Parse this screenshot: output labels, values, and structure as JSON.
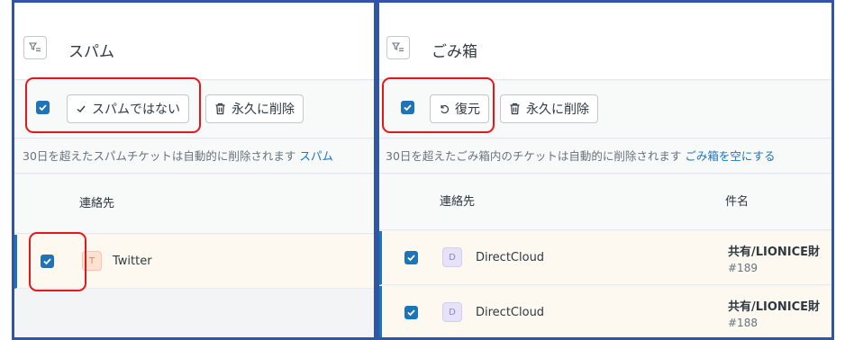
{
  "spam": {
    "title": "スパム",
    "not_spam_label": "スパムではない",
    "delete_label": "永久に削除",
    "notice_text": "30日を超えたスパムチケットは自動的に削除されます",
    "notice_link": "スパム",
    "contact_header": "連絡先",
    "rows": [
      {
        "avatar": "T",
        "contact": "Twitter"
      }
    ]
  },
  "trash": {
    "title": "ごみ箱",
    "restore_label": "復元",
    "delete_label": "永久に削除",
    "notice_text": "30日を超えたごみ箱内のチケットは自動的に削除されます",
    "notice_link": "ごみ箱を空にする",
    "contact_header": "連絡先",
    "subject_header": "件名",
    "rows": [
      {
        "avatar": "D",
        "contact": "DirectCloud",
        "subject": "共有/LIONICE財",
        "ticket": "#189"
      },
      {
        "avatar": "D",
        "contact": "DirectCloud",
        "subject": "共有/LIONICE財",
        "ticket": "#188"
      }
    ]
  },
  "icons": {
    "filter": "filter-icon",
    "check": "check-icon",
    "restore": "restore-icon",
    "trash": "trash-icon"
  },
  "colors": {
    "accent_blue": "#1f73b7",
    "highlight_red": "#e8151b",
    "panel_border": "#2f55a4"
  }
}
